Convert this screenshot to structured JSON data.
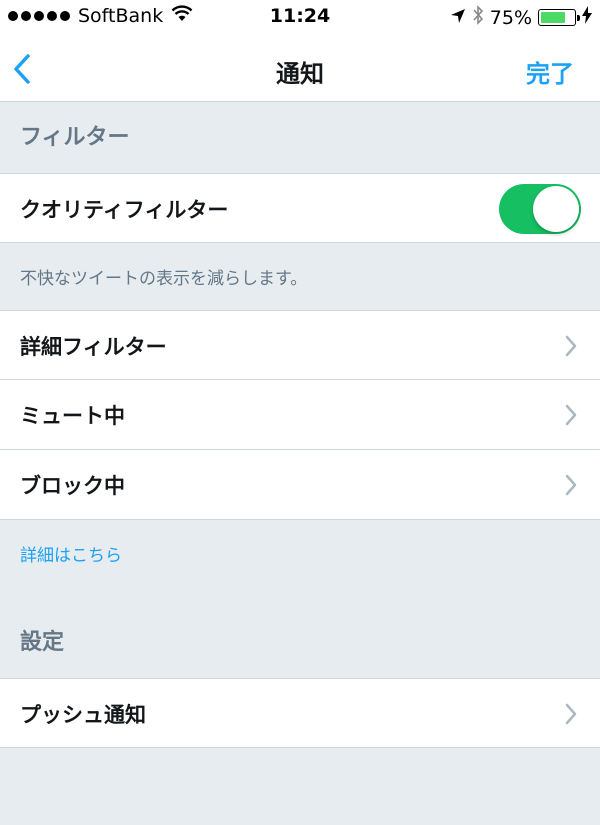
{
  "status_bar": {
    "carrier": "SoftBank",
    "time": "11:24",
    "battery_percent": "75%",
    "battery_level": 0.75
  },
  "nav": {
    "title": "通知",
    "done_label": "完了"
  },
  "filter_section": {
    "header": "フィルター",
    "quality_filter": {
      "label": "クオリティフィルター",
      "enabled": true
    },
    "quality_note": "不快なツイートの表示を減らします。",
    "items": [
      {
        "label": "詳細フィルター"
      },
      {
        "label": "ミュート中"
      },
      {
        "label": "ブロック中"
      }
    ],
    "learn_more": "詳細はこちら"
  },
  "settings_section": {
    "header": "設定",
    "items": [
      {
        "label": "プッシュ通知"
      }
    ]
  },
  "colors": {
    "accent": "#1da1f2",
    "toggle_on": "#17bf63",
    "background": "#e6ecf0"
  }
}
